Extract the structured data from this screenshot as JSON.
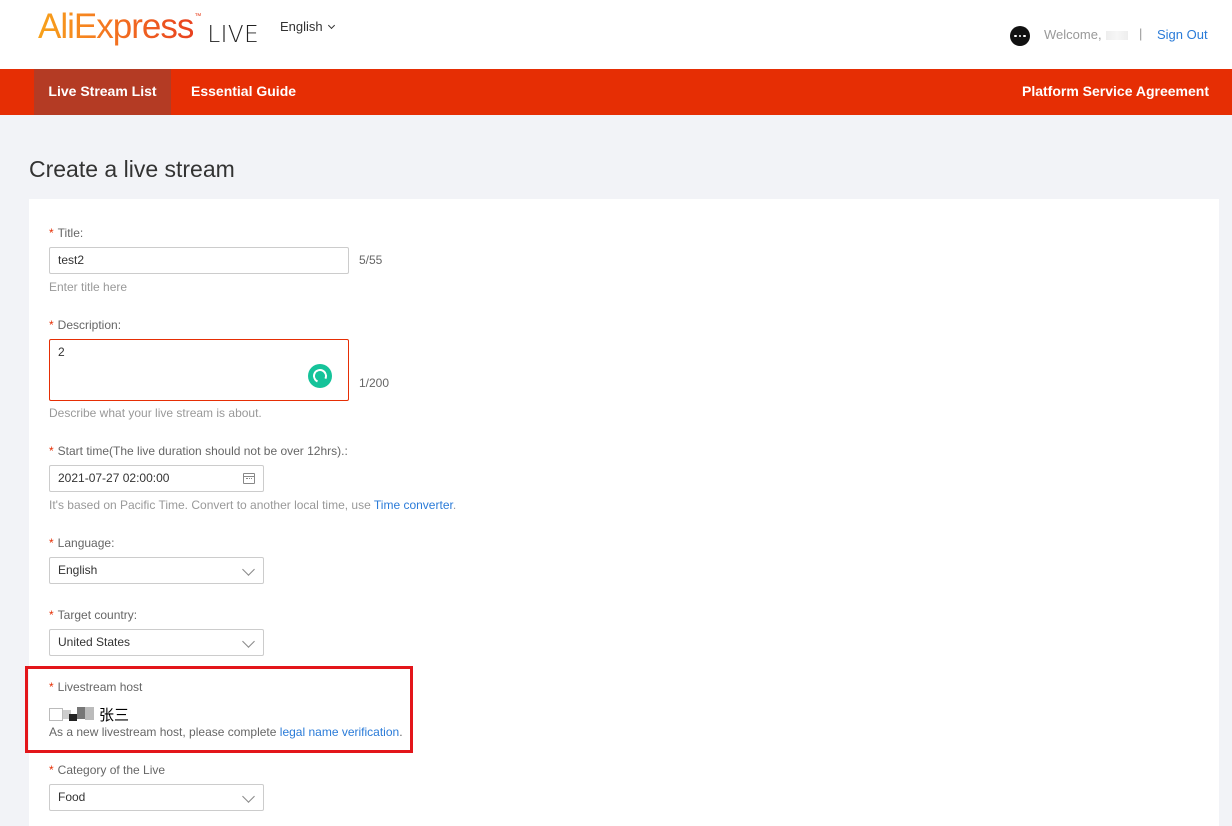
{
  "header": {
    "logo_main": "AliExpress",
    "logo_tm": "™",
    "logo_sub": "LIVE",
    "language": "English",
    "welcome": "Welcome,",
    "separator": "|",
    "sign_out": "Sign Out"
  },
  "nav": {
    "items": [
      {
        "label": "Live Stream List",
        "active": true
      },
      {
        "label": "Essential Guide",
        "active": false
      }
    ],
    "right_item": "Platform Service Agreement"
  },
  "page": {
    "title": "Create a live stream"
  },
  "form": {
    "required_mark": "*",
    "title": {
      "label": "Title:",
      "value": "test2",
      "counter": "5/55",
      "hint": "Enter title here"
    },
    "description": {
      "label": "Description:",
      "value": "2",
      "counter": "1/200",
      "hint": "Describe what your live stream is about."
    },
    "start_time": {
      "label": "Start time(The live duration should not be over 12hrs).:",
      "value": "2021-07-27 02:00:00",
      "hint_prefix": "It's based on Pacific Time. Convert to another local time, use",
      "hint_link": "Time converter",
      "hint_suffix": "."
    },
    "language": {
      "label": "Language:",
      "value": "English"
    },
    "target_country": {
      "label": "Target country:",
      "value": "United States"
    },
    "host": {
      "label": "Livestream host",
      "name": "张三",
      "hint_prefix": "As a new livestream host, please complete",
      "hint_link": "legal name verification",
      "hint_suffix": "."
    },
    "category": {
      "label": "Category of the Live",
      "value": "Food"
    }
  },
  "colors": {
    "brand_red": "#e62e04",
    "nav_active": "#b43b24",
    "link_blue": "#2a7bd8",
    "highlight_red": "#e3151a",
    "grammarly_green": "#15c39a"
  },
  "icons": [
    "chevron-down-icon",
    "chat-icon",
    "calendar-icon",
    "grammar-assistant-icon"
  ]
}
